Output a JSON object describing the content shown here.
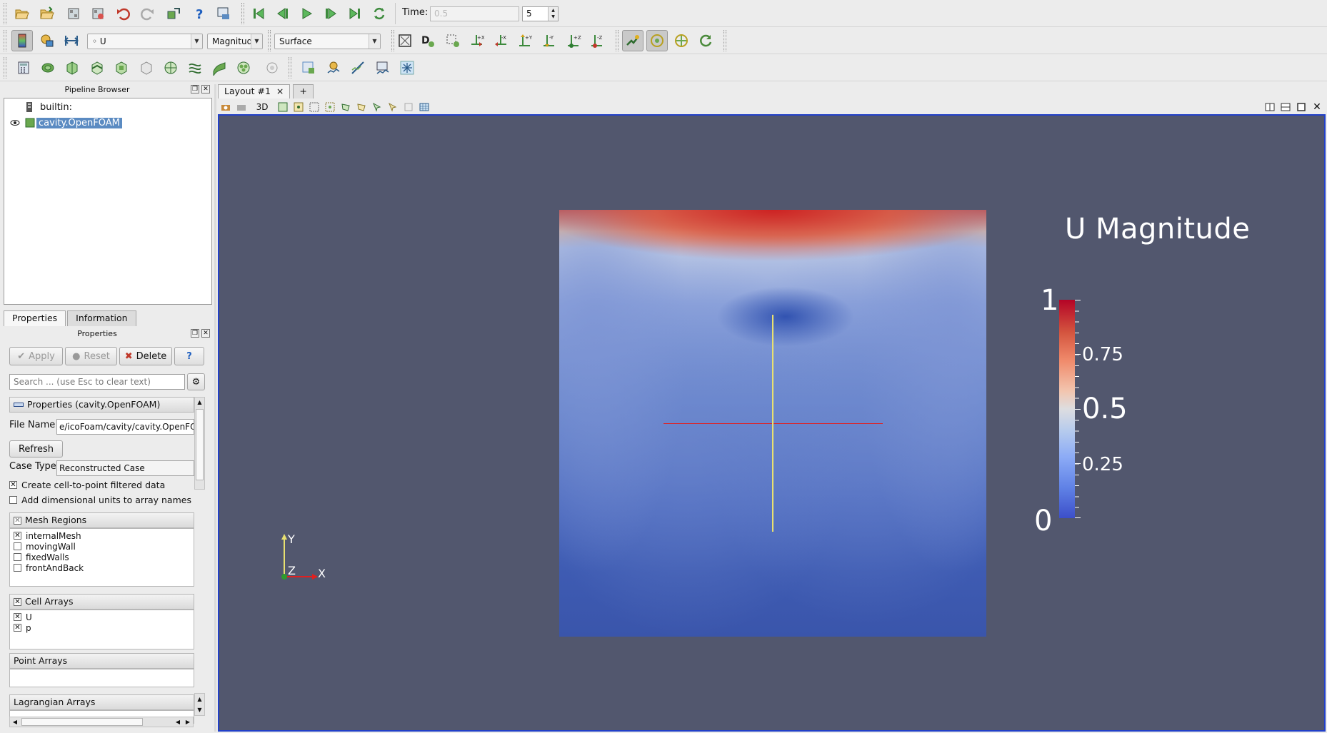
{
  "toolbar1": {
    "time_label": "Time:",
    "time_value": "0.5",
    "timestep_value": "5"
  },
  "toolbar2": {
    "variable_select": "U",
    "component_select": "Magnitude",
    "representation_select": "Surface",
    "orient_buttons": [
      "+X",
      "-X",
      "+Y",
      "-Y",
      "+Z",
      "-Z"
    ]
  },
  "pipeline_browser": {
    "title": "Pipeline Browser",
    "items": [
      {
        "label": "builtin:",
        "selected": false
      },
      {
        "label": "cavity.OpenFOAM",
        "selected": true
      }
    ]
  },
  "tabs": [
    "Properties",
    "Information"
  ],
  "properties": {
    "title": "Properties",
    "apply_label": "Apply",
    "reset_label": "Reset",
    "delete_label": "Delete",
    "help_label": "?",
    "search_placeholder": "Search ... (use Esc to clear text)",
    "section_title": "Properties (cavity.OpenFOAM)",
    "file_name_label": "File Name",
    "file_name_value": "e/icoFoam/cavity/cavity.OpenFOAM",
    "refresh_label": "Refresh",
    "case_type_label": "Case Type",
    "case_type_value": "Reconstructed Case",
    "create_cell_to_point": {
      "label": "Create cell-to-point filtered data",
      "checked": true
    },
    "add_units": {
      "label": "Add dimensional units to array names",
      "checked": false
    },
    "mesh_regions": {
      "title": "Mesh Regions",
      "items": [
        {
          "label": "internalMesh",
          "checked": true
        },
        {
          "label": "movingWall",
          "checked": false
        },
        {
          "label": "fixedWalls",
          "checked": false
        },
        {
          "label": "frontAndBack",
          "checked": false
        }
      ]
    },
    "cell_arrays": {
      "title": "Cell Arrays",
      "items": [
        {
          "label": "U",
          "checked": true
        },
        {
          "label": "p",
          "checked": true
        }
      ]
    },
    "point_arrays": {
      "title": "Point Arrays"
    },
    "lagrangian_arrays": {
      "title": "Lagrangian Arrays"
    }
  },
  "layout": {
    "tab_label": "Layout #1",
    "tab_close": "×",
    "add_tab": "+",
    "view_mode": "3D"
  },
  "render_view": {
    "background": "#52576e",
    "scalar_bar": {
      "title": "U Magnitude",
      "max_label": "1",
      "min_label": "0",
      "labels": [
        "0.75",
        "0.5",
        "0.25"
      ]
    },
    "axes": {
      "x": "X",
      "y": "Y",
      "z": "Z"
    }
  }
}
